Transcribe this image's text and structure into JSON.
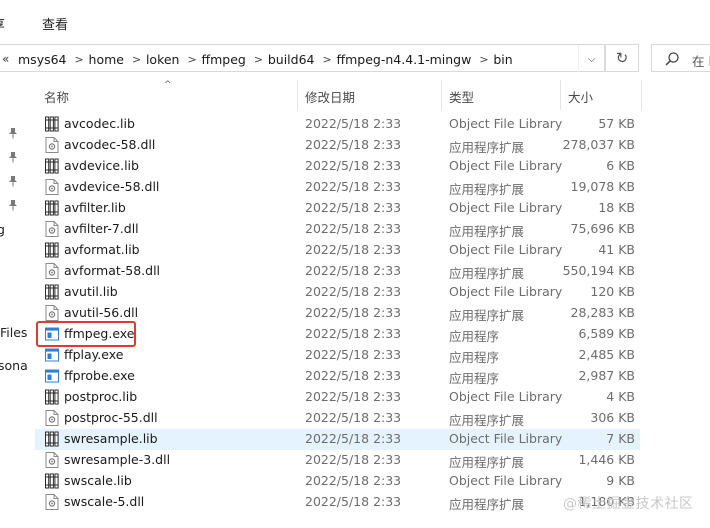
{
  "ribbon": {
    "tabs": [
      "享",
      "查看"
    ]
  },
  "address": {
    "overflow": "«",
    "crumbs": [
      "msys64",
      "home",
      "loken",
      "ffmpeg",
      "build64",
      "ffmpeg-n4.4.1-mingw",
      "bin"
    ],
    "separator": ">",
    "dropdown_glyph": "⌵",
    "refresh_glyph": "↻"
  },
  "search": {
    "placeholder": "在 l"
  },
  "nav": {
    "fragments": [
      "g",
      "Files",
      "sona"
    ]
  },
  "columns": {
    "name": "名称",
    "date": "修改日期",
    "type": "类型",
    "size": "大小",
    "sort_glyph": "^"
  },
  "files": [
    {
      "name": "avcodec.lib",
      "date": "2022/5/18 2:33",
      "type": "Object File Library",
      "size": "57 KB",
      "icon": "lib-icon"
    },
    {
      "name": "avcodec-58.dll",
      "date": "2022/5/18 2:33",
      "type": "应用程序扩展",
      "size": "278,037 KB",
      "icon": "dll-icon"
    },
    {
      "name": "avdevice.lib",
      "date": "2022/5/18 2:33",
      "type": "Object File Library",
      "size": "6 KB",
      "icon": "lib-icon"
    },
    {
      "name": "avdevice-58.dll",
      "date": "2022/5/18 2:33",
      "type": "应用程序扩展",
      "size": "19,078 KB",
      "icon": "dll-icon"
    },
    {
      "name": "avfilter.lib",
      "date": "2022/5/18 2:33",
      "type": "Object File Library",
      "size": "18 KB",
      "icon": "lib-icon"
    },
    {
      "name": "avfilter-7.dll",
      "date": "2022/5/18 2:33",
      "type": "应用程序扩展",
      "size": "75,696 KB",
      "icon": "dll-icon"
    },
    {
      "name": "avformat.lib",
      "date": "2022/5/18 2:33",
      "type": "Object File Library",
      "size": "41 KB",
      "icon": "lib-icon"
    },
    {
      "name": "avformat-58.dll",
      "date": "2022/5/18 2:33",
      "type": "应用程序扩展",
      "size": "550,194 KB",
      "icon": "dll-icon"
    },
    {
      "name": "avutil.lib",
      "date": "2022/5/18 2:33",
      "type": "Object File Library",
      "size": "120 KB",
      "icon": "lib-icon"
    },
    {
      "name": "avutil-56.dll",
      "date": "2022/5/18 2:33",
      "type": "应用程序扩展",
      "size": "28,283 KB",
      "icon": "dll-icon"
    },
    {
      "name": "ffmpeg.exe",
      "date": "2022/5/18 2:33",
      "type": "应用程序",
      "size": "6,589 KB",
      "icon": "exe-icon"
    },
    {
      "name": "ffplay.exe",
      "date": "2022/5/18 2:33",
      "type": "应用程序",
      "size": "2,485 KB",
      "icon": "exe-icon"
    },
    {
      "name": "ffprobe.exe",
      "date": "2022/5/18 2:33",
      "type": "应用程序",
      "size": "2,987 KB",
      "icon": "exe-icon"
    },
    {
      "name": "postproc.lib",
      "date": "2022/5/18 2:33",
      "type": "Object File Library",
      "size": "4 KB",
      "icon": "lib-icon"
    },
    {
      "name": "postproc-55.dll",
      "date": "2022/5/18 2:33",
      "type": "应用程序扩展",
      "size": "306 KB",
      "icon": "dll-icon"
    },
    {
      "name": "swresample.lib",
      "date": "2022/5/18 2:33",
      "type": "Object File Library",
      "size": "7 KB",
      "icon": "lib-icon",
      "selected": true
    },
    {
      "name": "swresample-3.dll",
      "date": "2022/5/18 2:33",
      "type": "应用程序扩展",
      "size": "1,446 KB",
      "icon": "dll-icon"
    },
    {
      "name": "swscale.lib",
      "date": "2022/5/18 2:33",
      "type": "Object File Library",
      "size": "9 KB",
      "icon": "lib-icon"
    },
    {
      "name": "swscale-5.dll",
      "date": "2022/5/18 2:33",
      "type": "应用程序扩展",
      "size": "1,180 KB",
      "icon": "dll-icon"
    }
  ],
  "watermark": "@稀土掘金技术社区",
  "colors": {
    "highlight": "#e03a2e",
    "selection": "#e5f3ff",
    "exe_blue": "#2f7fd6"
  }
}
